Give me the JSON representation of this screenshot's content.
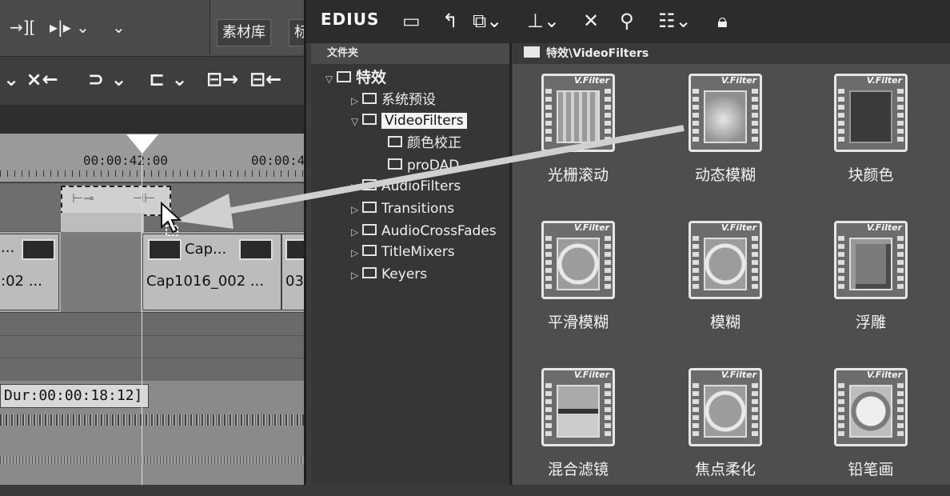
{
  "timeline": {
    "toolbar_top": [
      "→][",
      "▸|▸ ⌄",
      "⌄"
    ],
    "tabs": [
      "素材库",
      "标"
    ],
    "toolbar_second": [
      "⌄ ×←",
      "⊃ ⌄",
      "⊏ ⌄",
      "⊟→",
      "⊟←"
    ],
    "timecodes": [
      "00:00:42:00",
      "00:00:4"
    ],
    "clips": [
      {
        "top_label": "...",
        "bottom_label": ":02 ..."
      },
      {
        "top_label": "Cap...",
        "bottom_label": "Cap1016_002 ..."
      },
      {
        "top_label": "",
        "bottom_label": "03"
      }
    ],
    "duration_label": "Dur:00:00:18:12]"
  },
  "edius": {
    "title": "EDIUS",
    "toolbar_icons": [
      "folder-icon",
      "up-icon",
      "copy-icon",
      "import-icon",
      "delete-icon",
      "properties-icon",
      "view-icon",
      "lock-icon"
    ],
    "folder_header": "文件夹",
    "tree": [
      {
        "label": "特效",
        "indent": 0,
        "expanded": true
      },
      {
        "label": "系统预设",
        "indent": 1
      },
      {
        "label": "VideoFilters",
        "indent": 1,
        "selected": true,
        "expanded": true
      },
      {
        "label": "颜色校正",
        "indent": 2
      },
      {
        "label": "proDAD",
        "indent": 2
      },
      {
        "label": "AudioFilters",
        "indent": 1
      },
      {
        "label": "Transitions",
        "indent": 1
      },
      {
        "label": "AudioCrossFades",
        "indent": 1
      },
      {
        "label": "TitleMixers",
        "indent": 1
      },
      {
        "label": "Keyers",
        "indent": 1
      }
    ],
    "path": "特效\\VideoFilters",
    "filter_tag": "V.Filter",
    "filters": [
      {
        "name": "光栅滚动",
        "style": "wave"
      },
      {
        "name": "动态模糊",
        "style": "blur"
      },
      {
        "name": "块颜色",
        "style": "block"
      },
      {
        "name": "平滑模糊",
        "style": "circ"
      },
      {
        "name": "模糊",
        "style": "circ"
      },
      {
        "name": "浮雕",
        "style": "emboss"
      },
      {
        "name": "混合滤镜",
        "style": "mix"
      },
      {
        "name": "焦点柔化",
        "style": "circ"
      },
      {
        "name": "铅笔画",
        "style": "pencil"
      }
    ]
  }
}
